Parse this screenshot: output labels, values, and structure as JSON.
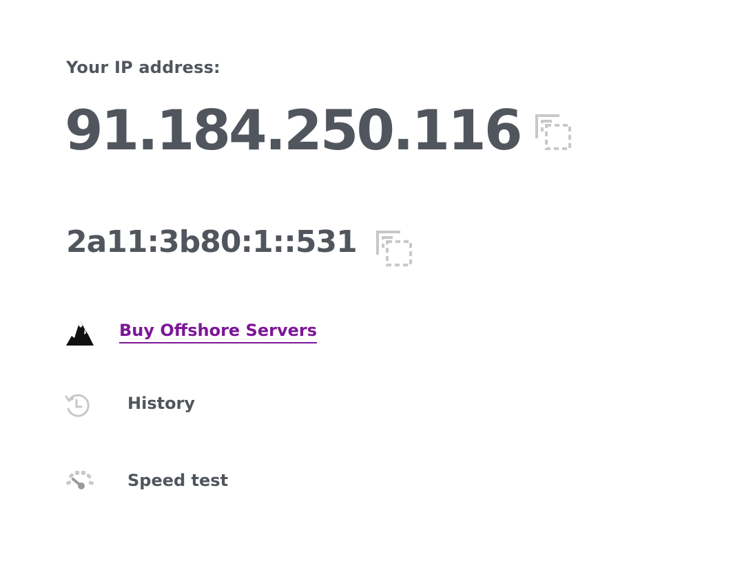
{
  "ip_section": {
    "label": "Your IP address:",
    "ipv4": "91.184.250.116",
    "ipv6": "2a11:3b80:1::531"
  },
  "links": {
    "offshore": "Buy Offshore Servers",
    "history": "History",
    "speed_test": "Speed test"
  },
  "icons": {
    "copy_ipv4": "copy-icon",
    "copy_ipv6": "copy-icon",
    "offshore": "mountain-icon",
    "history": "history-icon",
    "speed_test": "speedometer-icon"
  },
  "colors": {
    "text": "#51565e",
    "link": "#7c1697",
    "icon_muted": "#c8c8c8"
  }
}
